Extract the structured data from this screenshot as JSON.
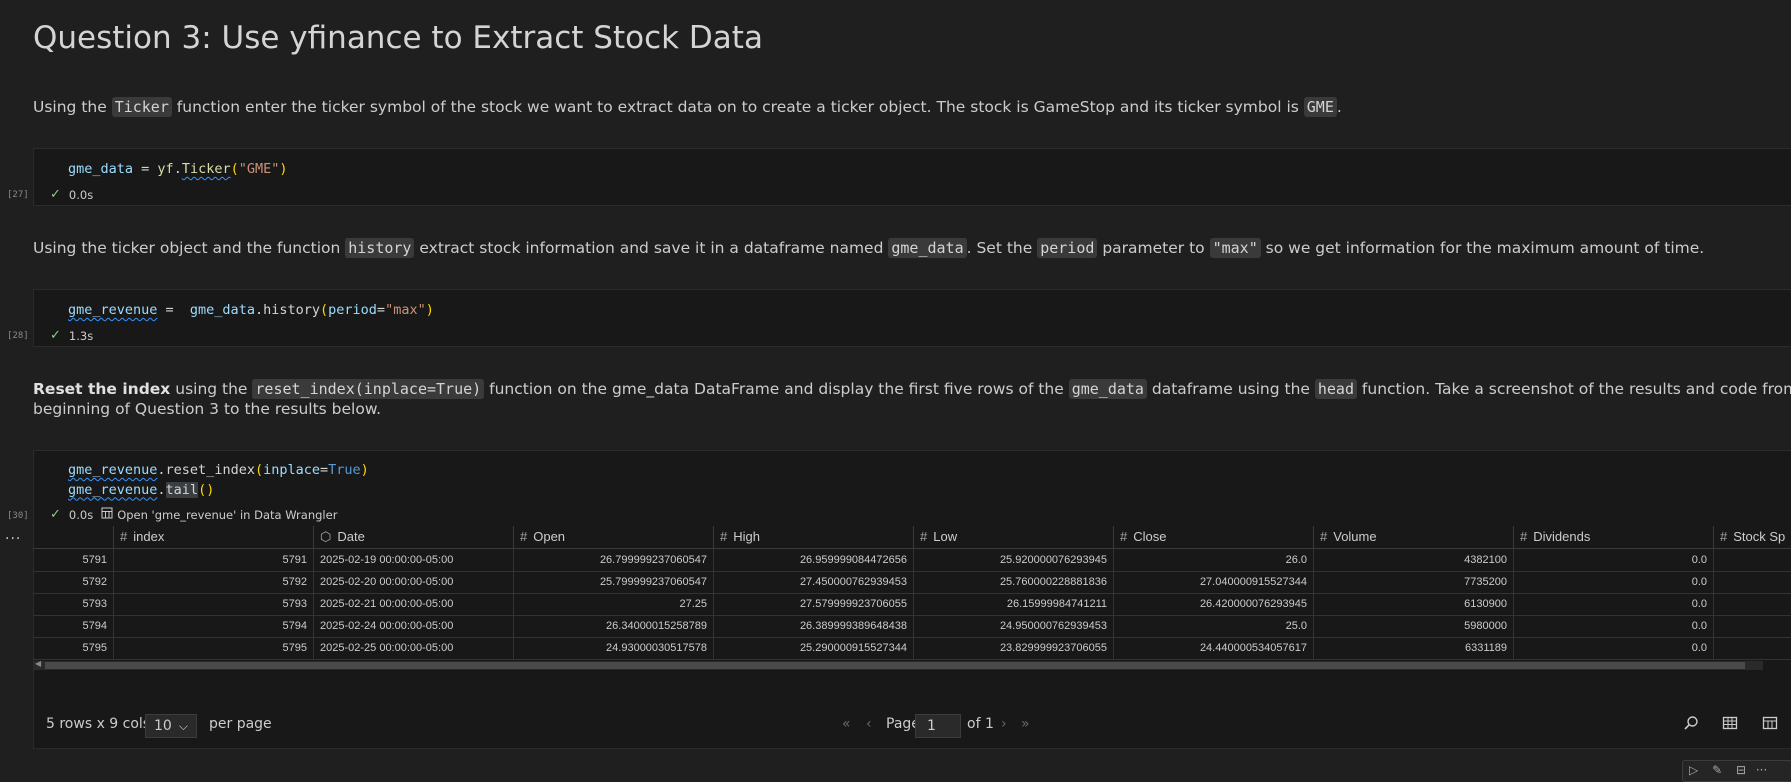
{
  "heading": "Question 3: Use yfinance to Extract Stock Data",
  "md1": {
    "t1": "Using the ",
    "c1": "Ticker",
    "t2": " function enter the ticker symbol of the stock we want to extract data on to create a ticker object. The stock is GameStop and its ticker symbol is ",
    "c2": "GME",
    "t3": "."
  },
  "cell1": {
    "var": "gme_data",
    "op": " = ",
    "mod": "yf",
    "dot": ".",
    "func": "Ticker",
    "open": "(",
    "arg": "\"GME\"",
    "close": ")",
    "count": "[27]",
    "time": "0.0s"
  },
  "md2": {
    "t1": "Using the ticker object and the function ",
    "c1": "history",
    "t2": " extract stock information and save it in a dataframe named ",
    "c2": "gme_data",
    "t3": ". Set the ",
    "c3": "period",
    "t4": " parameter to ",
    "c4": "\"max\"",
    "t5": " so we get information for the maximum amount of time."
  },
  "cell2": {
    "var": "gme_revenue",
    "op": " =  ",
    "obj": "gme_data",
    "dot": ".",
    "func": "history",
    "open": "(",
    "kw": "period",
    "eq": "=",
    "arg": "\"max\"",
    "close": ")",
    "count": "[28]",
    "time": "1.3s"
  },
  "md3": {
    "b1": "Reset the index",
    "t1": " using the ",
    "c1": "reset_index(inplace=True)",
    "t2": " function on the gme_data DataFrame and display the first five rows of the ",
    "c2": "gme_data",
    "t3": " dataframe using the ",
    "c3": "head",
    "t4": " function. Take a screenshot of the results and code from",
    "line2": "beginning of Question 3 to the results below."
  },
  "cell3": {
    "line1_var": "gme_revenue",
    "line1_dot": ".",
    "line1_func": "reset_index",
    "line1_open": "(",
    "line1_kw": "inplace",
    "line1_eq": "=",
    "line1_val": "True",
    "line1_close": ")",
    "line2_var": "gme_revenue",
    "line2_dot": ".",
    "line2_func": "tail",
    "line2_parens": "()",
    "count": "[30]",
    "time": "0.0s",
    "data_wrangler": "Open 'gme_revenue' in Data Wrangler"
  },
  "table": {
    "columns": [
      "index",
      "Date",
      "Open",
      "High",
      "Low",
      "Close",
      "Volume",
      "Dividends",
      "Stock Sp"
    ],
    "rows": [
      {
        "rownum": "5791",
        "index": "5791",
        "date": "2025-02-19 00:00:00-05:00",
        "open": "26.799999237060547",
        "high": "26.959999084472656",
        "low": "25.920000076293945",
        "close": "26.0",
        "volume": "4382100",
        "dividends": "0.0"
      },
      {
        "rownum": "5792",
        "index": "5792",
        "date": "2025-02-20 00:00:00-05:00",
        "open": "25.799999237060547",
        "high": "27.450000762939453",
        "low": "25.760000228881836",
        "close": "27.040000915527344",
        "volume": "7735200",
        "dividends": "0.0"
      },
      {
        "rownum": "5793",
        "index": "5793",
        "date": "2025-02-21 00:00:00-05:00",
        "open": "27.25",
        "high": "27.579999923706055",
        "low": "26.15999984741211",
        "close": "26.420000076293945",
        "volume": "6130900",
        "dividends": "0.0"
      },
      {
        "rownum": "5794",
        "index": "5794",
        "date": "2025-02-24 00:00:00-05:00",
        "open": "26.34000015258789",
        "high": "26.389999389648438",
        "low": "24.950000762939453",
        "close": "25.0",
        "volume": "5980000",
        "dividends": "0.0"
      },
      {
        "rownum": "5795",
        "index": "5795",
        "date": "2025-02-25 00:00:00-05:00",
        "open": "24.93000030517578",
        "high": "25.290000915527344",
        "low": "23.829999923706055",
        "close": "24.440000534057617",
        "volume": "6331189",
        "dividends": "0.0"
      }
    ]
  },
  "footer": {
    "rows_cols": "5 rows x 9 cols",
    "page_size": "10",
    "per_page": "per page",
    "page_label": "Page",
    "page_value": "1",
    "of_label": "of 1"
  },
  "icons": {
    "check": "check-icon",
    "data_wrangler": "data-wrangler-icon",
    "search": "search-icon",
    "table": "table-icon"
  }
}
